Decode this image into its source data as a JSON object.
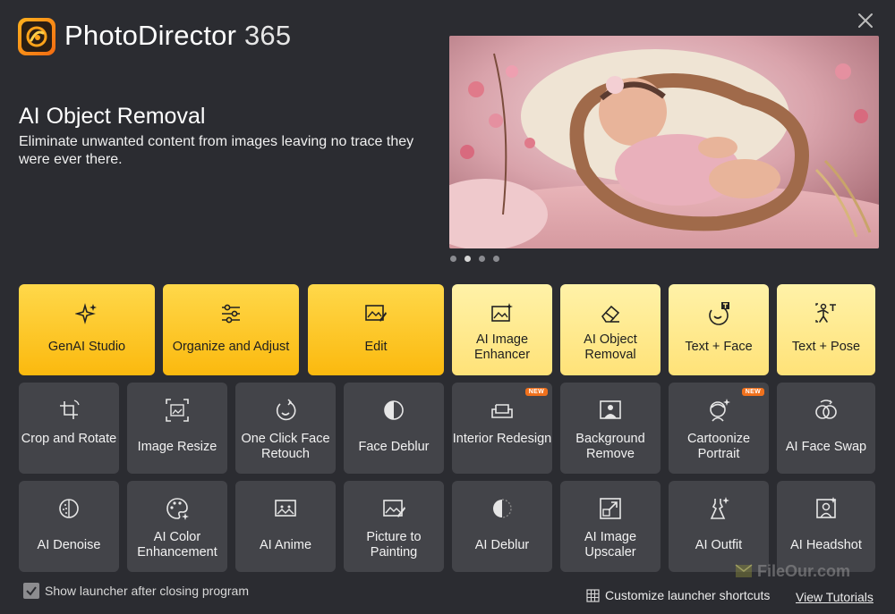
{
  "app": {
    "name": "PhotoDirector",
    "version": "365"
  },
  "feature": {
    "title": "AI Object Removal",
    "description": "Eliminate unwanted content from images leaving no trace they were ever there."
  },
  "carousel": {
    "slides": 4,
    "active_index": 1
  },
  "tiles_row1": [
    {
      "label": "GenAI Studio",
      "icon": "sparkles-icon"
    },
    {
      "label": "Organize and Adjust",
      "icon": "sliders-icon"
    },
    {
      "label": "Edit",
      "icon": "image-edit-icon"
    },
    {
      "label": "AI Image Enhancer",
      "icon": "image-sparkle-icon"
    },
    {
      "label": "AI Object Removal",
      "icon": "eraser-icon"
    },
    {
      "label": "Text + Face",
      "icon": "face-text-icon"
    },
    {
      "label": "Text + Pose",
      "icon": "pose-text-icon"
    }
  ],
  "tiles_row2": [
    {
      "label": "Crop and Rotate",
      "icon": "crop-rotate-icon"
    },
    {
      "label": "Image Resize",
      "icon": "resize-icon"
    },
    {
      "label": "One Click Face Retouch",
      "icon": "face-retouch-icon"
    },
    {
      "label": "Face Deblur",
      "icon": "half-circle-icon"
    },
    {
      "label": "Interior Redesign",
      "icon": "sofa-icon",
      "badge": "NEW"
    },
    {
      "label": "Background Remove",
      "icon": "person-image-icon"
    },
    {
      "label": "Cartoonize Portrait",
      "icon": "cartoon-face-icon",
      "badge": "NEW"
    },
    {
      "label": "AI Face Swap",
      "icon": "face-swap-icon"
    }
  ],
  "tiles_row3": [
    {
      "label": "AI Denoise",
      "icon": "denoise-icon"
    },
    {
      "label": "AI Color Enhancement",
      "icon": "palette-icon"
    },
    {
      "label": "AI Anime",
      "icon": "anime-image-icon"
    },
    {
      "label": "Picture to Painting",
      "icon": "painting-icon"
    },
    {
      "label": "AI Deblur",
      "icon": "deblur-icon"
    },
    {
      "label": "AI Image Upscaler",
      "icon": "upscale-icon"
    },
    {
      "label": "AI Outfit",
      "icon": "dress-icon"
    },
    {
      "label": "AI Headshot",
      "icon": "headshot-icon"
    }
  ],
  "footer": {
    "show_launcher_label": "Show launcher after closing program",
    "show_launcher_checked": true,
    "customize_label": "Customize launcher shortcuts",
    "tutorials_label": "View Tutorials"
  },
  "watermark": "FileOur.com",
  "colors": {
    "background": "#2b2c31",
    "tile_yellow": "#fbc61e",
    "tile_light_yellow": "#ffe78a",
    "tile_dark": "#434449",
    "badge": "#f0711d"
  }
}
